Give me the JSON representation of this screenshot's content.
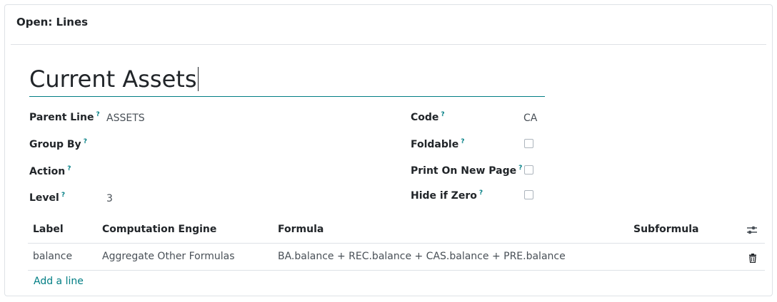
{
  "dialog": {
    "title": "Open: Lines"
  },
  "record": {
    "name": "Current Assets"
  },
  "fields": {
    "parent_line": {
      "label": "Parent Line",
      "tip": "?",
      "value": "ASSETS"
    },
    "group_by": {
      "label": "Group By",
      "tip": "?",
      "value": ""
    },
    "action": {
      "label": "Action",
      "tip": "?",
      "value": ""
    },
    "level": {
      "label": "Level",
      "tip": "?",
      "value": "3"
    },
    "code": {
      "label": "Code",
      "tip": "?",
      "value": "CA"
    },
    "foldable": {
      "label": "Foldable",
      "tip": "?",
      "checked": false
    },
    "print_on_new_page": {
      "label": "Print On New Page",
      "tip": "?",
      "checked": false
    },
    "hide_if_zero": {
      "label": "Hide if Zero",
      "tip": "?",
      "checked": false
    }
  },
  "expressions": {
    "columns": [
      "Label",
      "Computation Engine",
      "Formula",
      "Subformula"
    ],
    "rows": [
      {
        "label": "balance",
        "engine": "Aggregate Other Formulas",
        "formula": "BA.balance + REC.balance + CAS.balance + PRE.balance",
        "subformula": ""
      }
    ],
    "add_line": "Add a line"
  },
  "icons": {
    "column_settings": "sliders-icon",
    "delete": "trash-icon"
  },
  "colors": {
    "accent": "#017e84",
    "border": "#dee2e6"
  }
}
